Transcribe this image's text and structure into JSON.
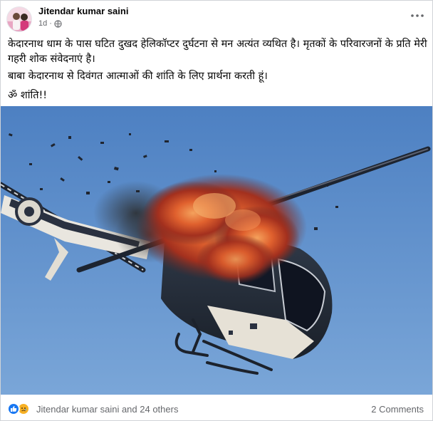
{
  "post": {
    "author": "Jitendar kumar saini",
    "time": "1d",
    "privacy_icon": "globe-icon",
    "menu_icon": "more-icon",
    "text": {
      "line1": "केदारनाथ धाम के पास घटित दुखद हेलिकॉप्टर दुर्घटना से मन अत्यंत व्यथित है। मृतकों के परिवारजनों के प्रति मेरी",
      "line2": "गहरी शोक संवेदनाएं है।",
      "line3": "बाबा केदारनाथ से दिवंगत आत्माओं की शांति के लिए प्रार्थना करती हूं।",
      "line4": "ॐ शांति!!"
    },
    "image": "helicopter-explosion-photo"
  },
  "footer": {
    "reactions": [
      "like",
      "sad"
    ],
    "reactors": "Jitendar kumar saini and 24 others",
    "comments": "2 Comments"
  },
  "colors": {
    "accent": "#1877f2",
    "meta_gray": "#65676b",
    "sky": "#5a8bc8"
  }
}
